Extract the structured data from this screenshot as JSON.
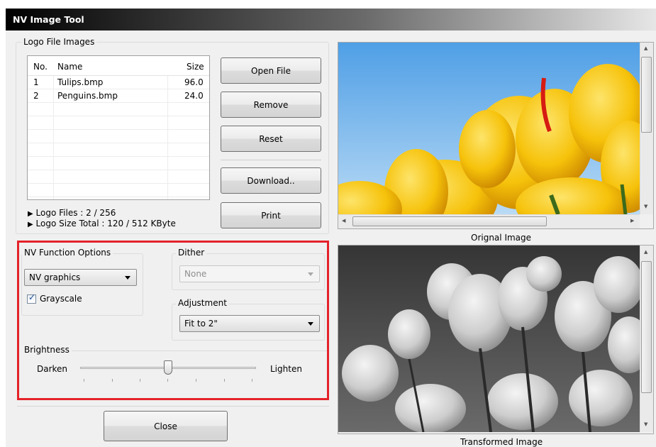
{
  "window": {
    "title": "NV Image Tool"
  },
  "logo_group": {
    "label": "Logo File Images",
    "columns": [
      "No.",
      "Name",
      "Size"
    ],
    "rows": [
      {
        "no": "1",
        "name": "Tulips.bmp",
        "size": "96.0"
      },
      {
        "no": "2",
        "name": "Penguins.bmp",
        "size": "24.0"
      }
    ],
    "logo_files": "Logo Files : 2 / 256",
    "logo_size_total": "Logo Size Total : 120 / 512 KByte"
  },
  "buttons": {
    "open_file": "Open File",
    "remove": "Remove",
    "reset": "Reset",
    "download": "Download..",
    "print": "Print",
    "close": "Close"
  },
  "nv_function": {
    "label": "NV Function Options",
    "selected": "NV graphics",
    "grayscale_label": "Grayscale",
    "grayscale_checked": true
  },
  "dither": {
    "label": "Dither",
    "selected": "None",
    "enabled": false
  },
  "adjustment": {
    "label": "Adjustment",
    "selected": "Fit to 2\""
  },
  "brightness": {
    "label": "Brightness",
    "min_label": "Darken",
    "max_label": "Lighten",
    "level": 0.5
  },
  "images": {
    "original_caption": "Orignal Image",
    "transformed_caption": "Transformed Image"
  },
  "colors": {
    "highlight": "#e4232a",
    "tulip_yellow": "#f6c20a",
    "sky_blue": "#5fa8e8"
  },
  "icons": {
    "bullet": "triangle-right-icon",
    "check": "check-icon",
    "dropdown": "chevron-down-icon"
  }
}
